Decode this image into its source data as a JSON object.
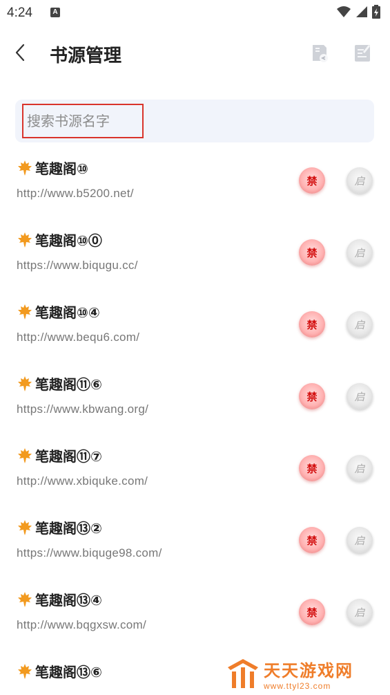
{
  "status_bar": {
    "time": "4:24",
    "notification_letter": "A"
  },
  "app_bar": {
    "title": "书源管理"
  },
  "search": {
    "placeholder": "搜索书源名字"
  },
  "sources": [
    {
      "name": "笔趣阁⑩",
      "url": "http://www.b5200.net/",
      "ban_label": "禁",
      "enable_label": "启"
    },
    {
      "name": "笔趣阁⑩⓪",
      "url": "https://www.biqugu.cc/",
      "ban_label": "禁",
      "enable_label": "启"
    },
    {
      "name": "笔趣阁⑩④",
      "url": "http://www.bequ6.com/",
      "ban_label": "禁",
      "enable_label": "启"
    },
    {
      "name": "笔趣阁⑪⑥",
      "url": "https://www.kbwang.org/",
      "ban_label": "禁",
      "enable_label": "启"
    },
    {
      "name": "笔趣阁⑪⑦",
      "url": "http://www.xbiquke.com/",
      "ban_label": "禁",
      "enable_label": "启"
    },
    {
      "name": "笔趣阁⑬②",
      "url": "https://www.biquge98.com/",
      "ban_label": "禁",
      "enable_label": "启"
    },
    {
      "name": "笔趣阁⑬④",
      "url": "http://www.bqgxsw.com/",
      "ban_label": "禁",
      "enable_label": "启"
    },
    {
      "name": "笔趣阁⑬⑥",
      "url": "",
      "ban_label": "",
      "enable_label": ""
    }
  ],
  "watermark": {
    "main": "天天游戏网",
    "url": "www.ttyl23.com"
  },
  "icons": {
    "back": "chevron-left-icon",
    "import": "import-file-icon",
    "edit": "edit-note-icon",
    "leaf": "maple-leaf-icon",
    "wifi": "wifi-icon",
    "signal": "signal-icon",
    "battery": "battery-icon"
  },
  "colors": {
    "accent_red": "#d41010",
    "search_border": "#d9342b",
    "watermark_orange": "#ef7d2a"
  }
}
